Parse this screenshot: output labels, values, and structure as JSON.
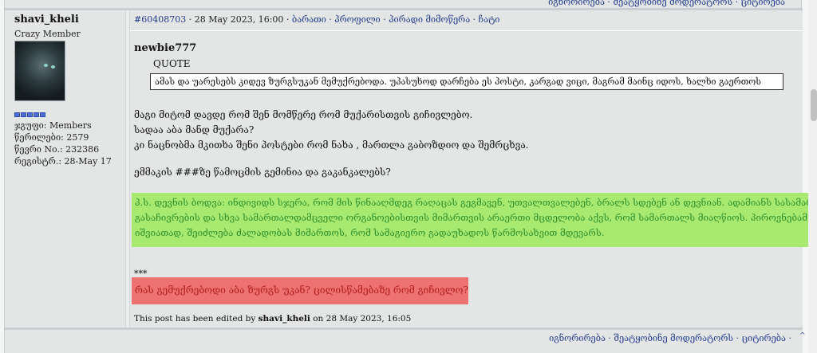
{
  "top_bar": {
    "links_text": "იგნორირება · შეატყობინე მოდერატორს · ციტირება"
  },
  "author": {
    "username": "shavi_kheli",
    "title": "Crazy Member",
    "group": "ჯგუფი: Members",
    "posts": "წერილები: 2579",
    "member_no": "წევრი No.: 232386",
    "registered": "რეგისტრ.: 28-May 17"
  },
  "post": {
    "id": "#60408703",
    "date": " · 28 May 2023, 16:00 · ",
    "actions": [
      "ბარათი",
      "პროფილი",
      "პირადი მიმოწერა",
      "ჩატი"
    ],
    "quote": {
      "author": "newbie777",
      "label": "QUOTE",
      "text": "ამას და უარესებს კიდევ ზურგსუკან მემუქრებოდა. უპასუხოდ დარჩება ეს პოსტი, კარგად ვიცი, მაგრამ მაინც იდოს, ხალხი გაერთოს"
    },
    "body": [
      "მაგი მიტომ დავდე რომ შენ მომწერე რომ მუქარისთვის გიჩივლებო.",
      "სადაა აბა მანდ მუქარა?",
      "კი ნაცნობმა მკითხა შენი პოსტები რომ ნახა , მართლა გაბოზდიო და შემრცხვა."
    ],
    "question": "ემმაკის ###ზე წამოცმის გემინია და გაკანკალებს?",
    "ps_lines": [
      "პ.ს. დევნის ბოდვა: ინდივიდს სჯერა, რომ მის წინააღმდეგ რაღაცას გეგმავენ, უთვალთვალებენ, ბრალს სდებენ ან დევნიან. ადამიანს სასამართლოში",
      "გასაჩივრების და სხვა სამართალდამცველი ორგანოებისთვის მიმართვის არაერთი მცდელობა აქვს, რომ სამართალს მიაღწიოს. პიროვნებამ,",
      "იშვიათად, შეიძლება ძალადობას მიმართოს, რომ სამაგიერო გადაუხადოს წარმოსახვით მდევარს."
    ],
    "stars": "***",
    "red_text": "რას გემუქრებოდი აბა ზურგს უკან? ცილისწამებაზე რომ გიჩივლო?",
    "edited_prefix": "This post has been edited by ",
    "edited_by": "shavi_kheli",
    "edited_suffix": " on 28 May 2023, 16:05"
  },
  "footer": {
    "links_text": "იგნორირება · შეატყობინე მოდერატორს  · ციტირება ·",
    "up_glyph": "^"
  },
  "colors": {
    "link": "#223c8e",
    "green_highlight": "#a7ea6f",
    "green_text": "#2e8f2e",
    "red_highlight": "#ee7272",
    "red_text": "#b11e1e",
    "pip": "#4f6fd7"
  }
}
